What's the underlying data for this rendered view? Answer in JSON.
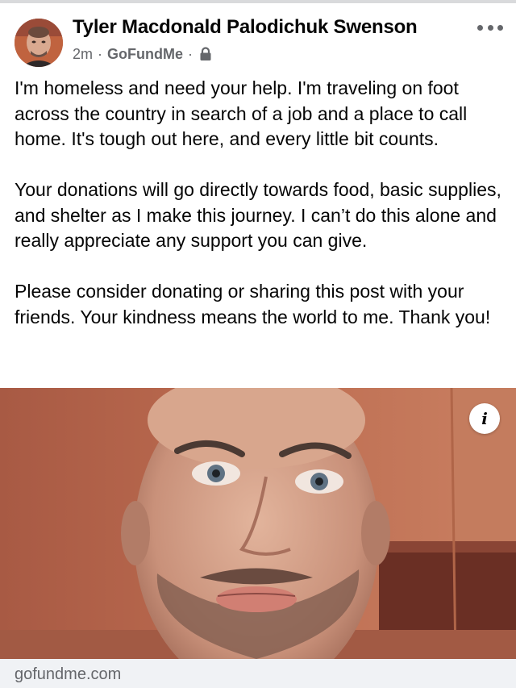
{
  "post": {
    "author_name": "Tyler Macdonald Palodichuk Swenson",
    "timestamp": "2m",
    "separator": "·",
    "source": "GoFundMe",
    "privacy_icon": "lock-icon",
    "more_icon": "more-horizontal-icon",
    "paragraphs": [
      "I'm homeless and need your help. I'm traveling on foot across the country in search of a job and a place to call home. It's tough out here, and every little bit counts.",
      "Your donations will go directly towards food, basic supplies, and shelter as I make this journey. I can’t do this alone and really appreciate any support you can give.",
      "Please consider donating or sharing this post with your friends. Your kindness means the world to me. Thank you!"
    ]
  },
  "media": {
    "info_label": "i",
    "link_domain": "gofundme.com"
  },
  "colors": {
    "text_primary": "#050505",
    "text_secondary": "#65676b",
    "link_bar_bg": "#f0f2f5",
    "photo_wall": "#b9674a"
  }
}
